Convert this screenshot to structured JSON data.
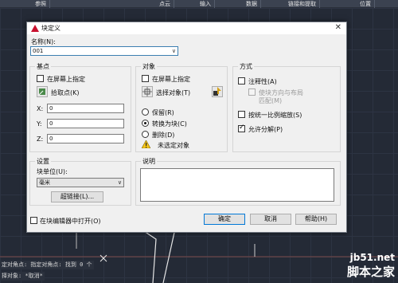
{
  "ribbon": {
    "tabs": [
      "参照",
      "点云",
      "输入",
      "数据",
      "链接和提取",
      "位置"
    ]
  },
  "command_line": {
    "line1": "定对角点: 指定对角点: 找到 0 个",
    "line2": "择对象: *取消*"
  },
  "watermark": {
    "url": "jb51.net",
    "name": "脚本之家"
  },
  "dialog": {
    "title": "块定义",
    "close_glyph": "✕",
    "name": {
      "label": "名称(N):",
      "value": "001"
    },
    "base_point": {
      "title": "基点",
      "specify_on_screen": "在屏幕上指定",
      "pick_point": "拾取点(K)",
      "x_label": "X:",
      "x_value": "0",
      "y_label": "Y:",
      "y_value": "0",
      "z_label": "Z:",
      "z_value": "0"
    },
    "objects": {
      "title": "对象",
      "specify_on_screen": "在屏幕上指定",
      "select_objects": "选择对象(T)",
      "retain": "保留(R)",
      "convert_to_block": "转换为块(C)",
      "delete": "删除(D)",
      "selected_status": "未选定对象",
      "selected_option": "convert_to_block"
    },
    "behavior": {
      "title": "方式",
      "annotative": "注释性(A)",
      "match_orientation_line1": "使块方向与布局",
      "match_orientation_line2": "匹配(M)",
      "scale_uniformly": "按统一比例缩放(S)",
      "allow_exploding": "允许分解(P)",
      "allow_exploding_checked": true
    },
    "settings": {
      "title": "设置",
      "block_unit_label": "块单位(U):",
      "block_unit_value": "毫米",
      "hyperlink_button": "超链接(L)..."
    },
    "description": {
      "title": "说明"
    },
    "open_in_editor": "在块编辑器中打开(O)",
    "buttons": {
      "ok": "确定",
      "cancel": "取消",
      "help": "帮助(H)"
    },
    "combo_arrow": "∨"
  },
  "colors": {
    "accent_blue": "#0078d7",
    "warning_yellow": "#f5c518",
    "app_red": "#c8102e"
  }
}
